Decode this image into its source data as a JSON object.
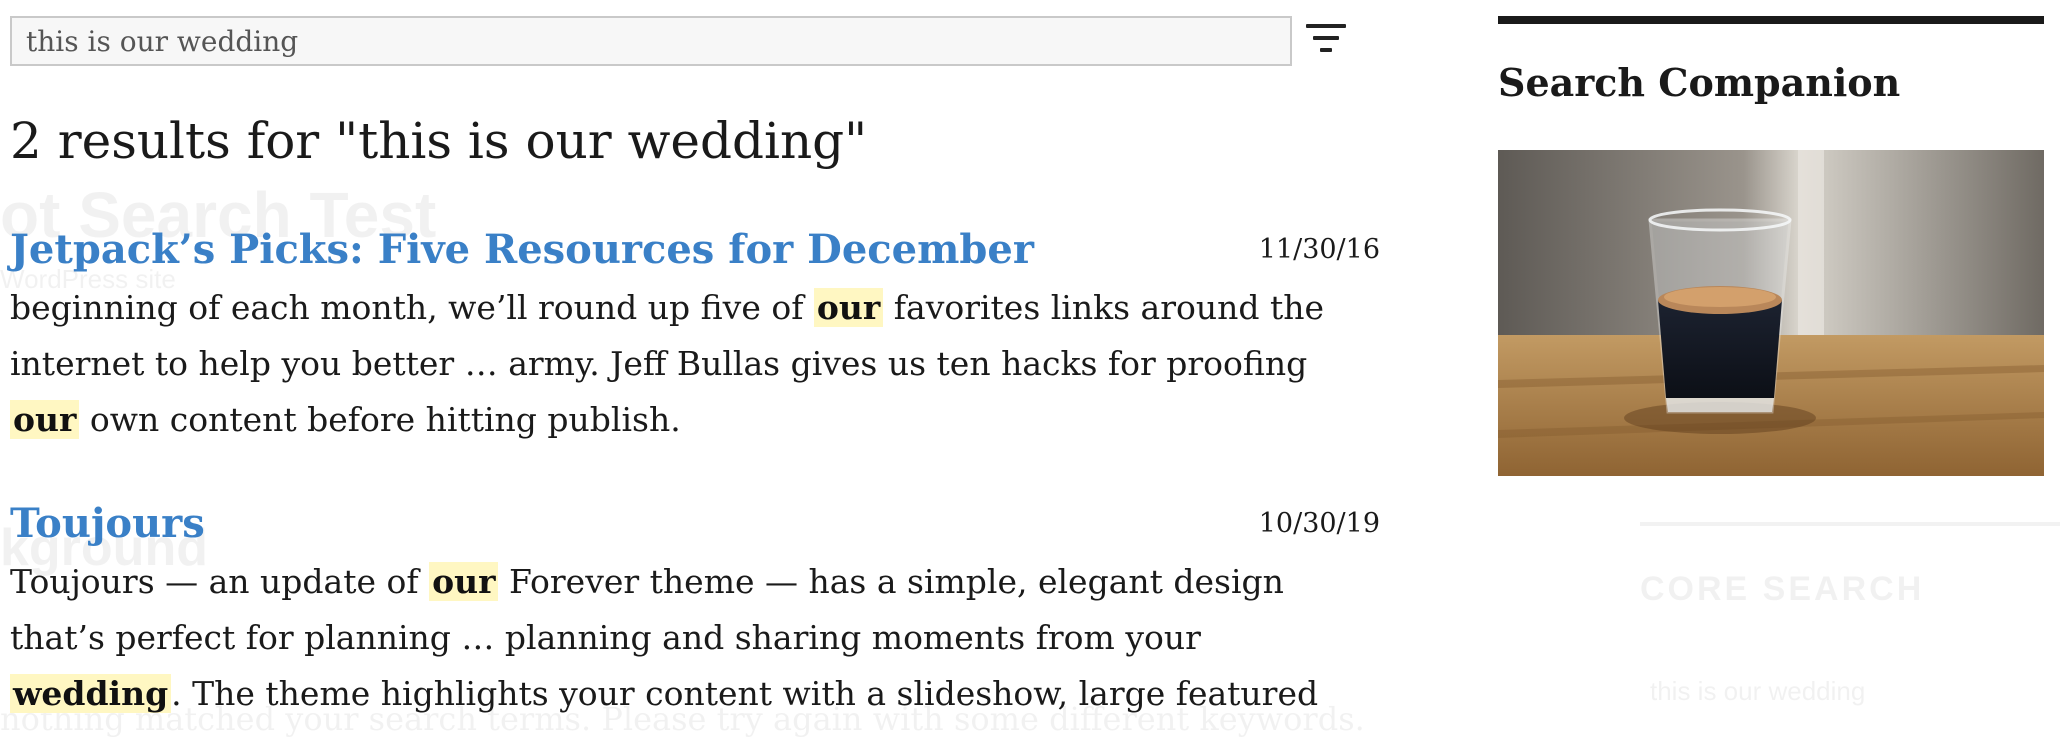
{
  "search": {
    "value": "this is our wedding"
  },
  "filter": {
    "icon": "filter-icon"
  },
  "results_heading": "2 results for \"this is our wedding\"",
  "results": [
    {
      "title": "Jetpack’s Picks: Five Resources for December",
      "date": "11/30/16",
      "excerpt": [
        {
          "t": "beginning of each month, we’ll round up five of "
        },
        {
          "t": "our",
          "hl": true
        },
        {
          "t": " favorites links around the internet to help you better … army. Jeff Bullas gives us ten hacks for proofing "
        },
        {
          "t": "our",
          "hl": true
        },
        {
          "t": " own content before hitting publish."
        }
      ]
    },
    {
      "title": "Toujours",
      "date": "10/30/19",
      "excerpt": [
        {
          "t": "Toujours — an update of "
        },
        {
          "t": "our",
          "hl": true
        },
        {
          "t": " Forever theme — has a simple, elegant design that’s perfect for planning … planning and sharing moments from your "
        },
        {
          "t": "wedding",
          "hl": true
        },
        {
          "t": ". The theme highlights your content with a slideshow, large featured"
        }
      ]
    }
  ],
  "sidebar": {
    "title": "Search Companion",
    "image_alt": "Espresso glass on a wooden table"
  },
  "background": {
    "site_title": "ot Search Test",
    "tagline": "WordPress site",
    "section": "kground",
    "no_match": "nothing matched your search terms. Please try again with some different keywords.",
    "core_search": "CORE SEARCH",
    "core_input": "this is our wedding"
  },
  "colors": {
    "link": "#3a80c7",
    "highlight": "#fff7c2",
    "text": "#1a1a1a"
  }
}
